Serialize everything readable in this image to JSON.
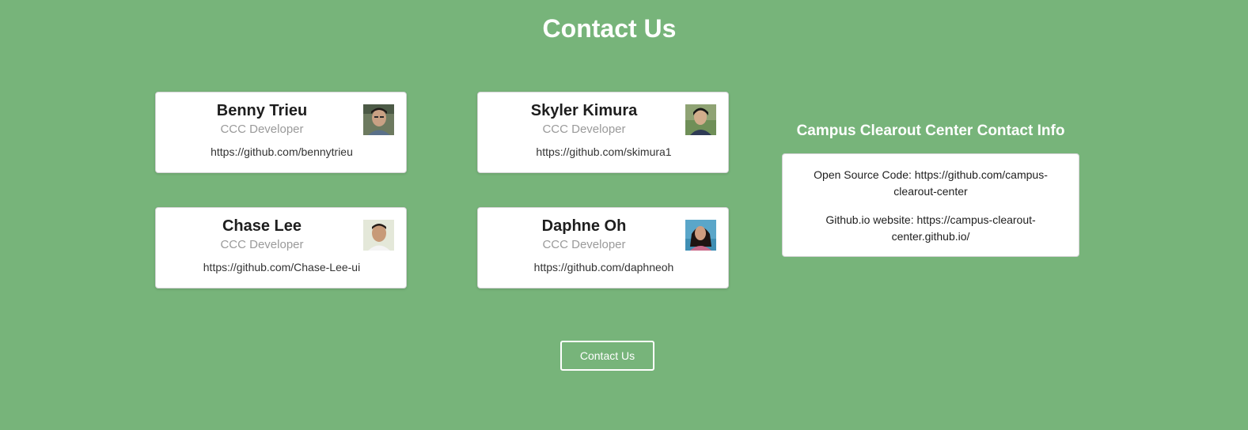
{
  "page": {
    "title": "Contact Us",
    "background_color": "#77b47a"
  },
  "developers": [
    {
      "name": "Benny Trieu",
      "role": "CCC Developer",
      "link": "https://github.com/bennytrieu"
    },
    {
      "name": "Skyler Kimura",
      "role": "CCC Developer",
      "link": "https://github.com/skimura1"
    },
    {
      "name": "Chase Lee",
      "role": "CCC Developer",
      "link": "https://github.com/Chase-Lee-ui"
    },
    {
      "name": "Daphne Oh",
      "role": "CCC Developer",
      "link": "https://github.com/daphneoh"
    }
  ],
  "info": {
    "title": "Campus Clearout Center Contact Info",
    "open_source": "Open Source Code: https://github.com/campus-clearout-center",
    "website": "Github.io website: https://campus-clearout-center.github.io/"
  },
  "contact_button": {
    "label": "Contact Us"
  }
}
